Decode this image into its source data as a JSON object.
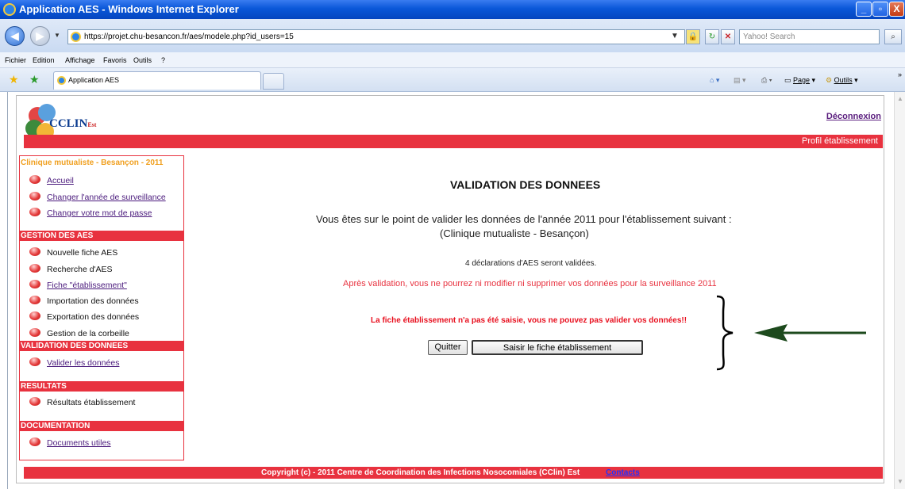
{
  "window": {
    "title": "Application AES - Windows Internet Explorer",
    "minimize": "_",
    "maximize": "▫",
    "close": "X"
  },
  "addressbar": {
    "url": "https://projet.chu-besancon.fr/aes/modele.php?id_users=15",
    "search_placeholder": "Yahoo! Search"
  },
  "menu": [
    "Fichier",
    "Edition",
    "Affichage",
    "Favoris",
    "Outils",
    "?"
  ],
  "tab": {
    "label": "Application AES"
  },
  "commands": {
    "page": "Page",
    "outils": "Outils"
  },
  "header": {
    "logo_text": "CCLIN",
    "logo_suffix": "Est",
    "logout": "Déconnexion",
    "profile": "Profil établissement"
  },
  "sidebar": {
    "title": "Clinique mutualiste - Besançon - 2011",
    "top_items": [
      "Accueil",
      "Changer l'année de surveillance",
      "Changer votre mot de passe"
    ],
    "sections": [
      {
        "heading": "GESTION DES AES",
        "items": [
          "Nouvelle fiche AES",
          "Recherche d'AES",
          "Fiche \"établissement\"",
          "Importation des données",
          "Exportation des données",
          "Gestion de la corbeille"
        ]
      },
      {
        "heading": "VALIDATION DES DONNEES",
        "items": [
          "Valider les données"
        ]
      },
      {
        "heading": "RESULTATS",
        "items": [
          "Résultats établissement"
        ]
      },
      {
        "heading": "DOCUMENTATION",
        "items": [
          "Documents utiles"
        ]
      }
    ]
  },
  "main": {
    "title": "VALIDATION DES DONNEES",
    "line1": "Vous êtes sur le point de valider les données de l'année 2011 pour l'établissement suivant :",
    "line2": "(Clinique mutualiste - Besançon)",
    "count": "4 déclarations d'AES seront validées.",
    "warning": "Après validation, vous ne pourrez ni modifier ni supprimer vos données pour la surveillance 2011",
    "error": "La fiche établissement n'a pas été saisie, vous ne pouvez pas valider vos données!!",
    "quit_button": "Quitter",
    "fiche_button": "Saisir le fiche établissement"
  },
  "footer": {
    "copyright": "Copyright (c) - 2011 Centre de Coordination des Infections Nosocomiales (CClin) Est",
    "contacts": "Contacts"
  }
}
